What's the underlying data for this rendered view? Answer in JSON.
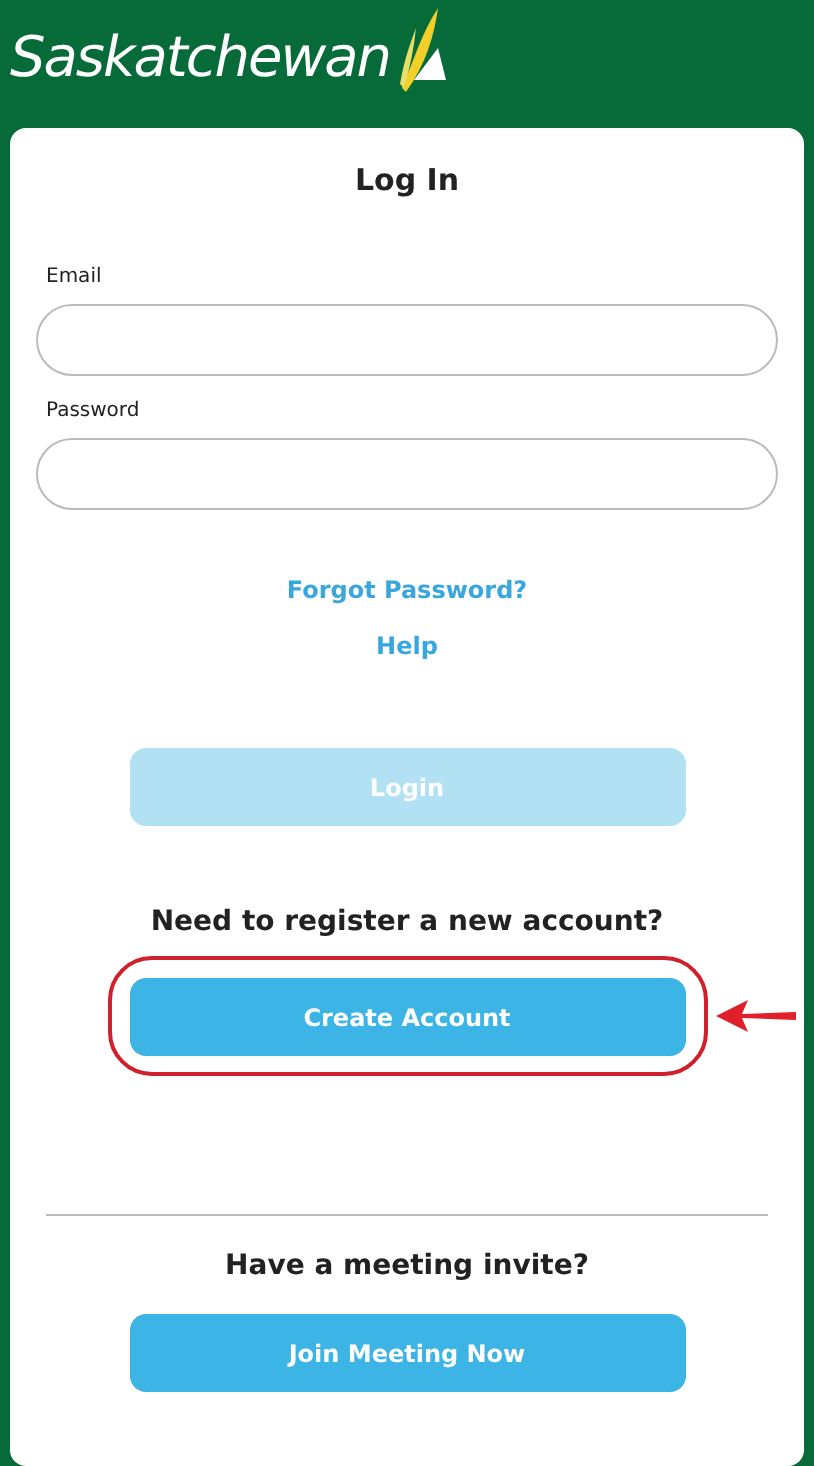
{
  "header": {
    "logo_text": "Saskatchewan"
  },
  "login_card": {
    "title": "Log In",
    "fields": [
      {
        "label": "Email"
      },
      {
        "label": "Password"
      }
    ],
    "links": [
      "Forgot Password?",
      "Help"
    ],
    "login_button": {
      "label": "Login",
      "disabled": true
    },
    "register_prompt": "Need to register a new account?",
    "create_button": {
      "label": "Create Account",
      "highlighted": true
    },
    "meeting_prompt": "Have a meeting invite?",
    "join_button": {
      "label": "Join Meeting Now"
    }
  }
}
